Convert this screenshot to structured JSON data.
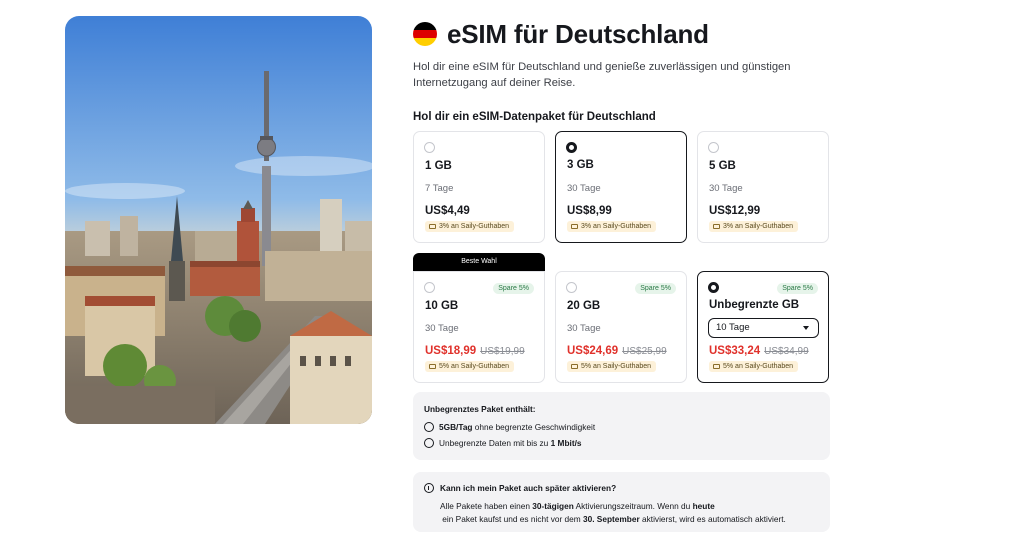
{
  "hero": {
    "image": "berlin-skyline-tv-tower-photo"
  },
  "header": {
    "flag_colors": [
      "#000000",
      "#dd0000",
      "#ffce00"
    ],
    "title": "eSIM für Deutschland",
    "intro": "Hol dir eine eSIM für Deutschland und genieße zuverlässigen und günstigen Internetzugang auf deiner Reise.",
    "section_label": "Hol dir ein eSIM-Datenpaket für Deutschland"
  },
  "best_tab": "Beste Wahl",
  "plans": [
    {
      "data": "1 GB",
      "days": "7 Tage",
      "price": "US$4,49",
      "old_price": "",
      "badge": "",
      "credit": "3% an Saily-Guthaben",
      "selected": false
    },
    {
      "data": "3 GB",
      "days": "30 Tage",
      "price": "US$8,99",
      "old_price": "",
      "badge": "",
      "credit": "3% an Saily-Guthaben",
      "selected": true
    },
    {
      "data": "5 GB",
      "days": "30 Tage",
      "price": "US$12,99",
      "old_price": "",
      "badge": "",
      "credit": "3% an Saily-Guthaben",
      "selected": false
    },
    {
      "data": "10 GB",
      "days": "30 Tage",
      "price": "US$18,99",
      "old_price": "US$19,99",
      "badge": "Spare 5%",
      "credit": "5% an Saily-Guthaben",
      "selected": false
    },
    {
      "data": "20 GB",
      "days": "30 Tage",
      "price": "US$24,69",
      "old_price": "US$25,99",
      "badge": "Spare 5%",
      "credit": "5% an Saily-Guthaben",
      "selected": false
    },
    {
      "data": "Unbegrenzte GB",
      "days": "10 Tage",
      "price": "US$33,24",
      "old_price": "US$34,99",
      "badge": "Spare 5%",
      "credit": "5% an Saily-Guthaben",
      "selected": true
    }
  ],
  "unlimited_box": {
    "title": "Unbegrenztes Paket enthält:",
    "line1_bold": "5GB/Tag",
    "line1_rest": " ohne begrenzte Geschwindigkeit",
    "line2_rest": "Unbegrenzte Daten mit bis zu ",
    "line2_bold": "1 Mbit/s"
  },
  "faq_box": {
    "question": "Kann ich mein Paket auch später aktivieren?",
    "answer_1": "Alle Pakete haben einen ",
    "answer_b1": "30-tägigen",
    "answer_2": " Aktivierungszeitraum. Wenn du ",
    "answer_b2": "heute",
    "answer_3": " ein Paket kaufst und es nicht vor dem ",
    "answer_b3": "30. September",
    "answer_4": " aktivierst, wird es automatisch aktiviert."
  }
}
